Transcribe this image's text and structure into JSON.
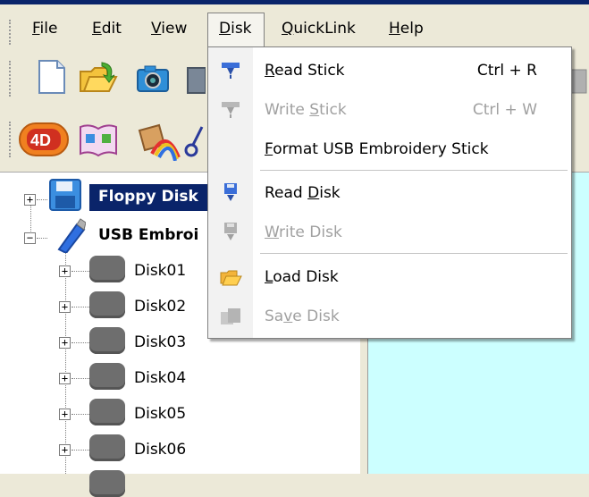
{
  "menubar": {
    "items": [
      {
        "label": "File",
        "u": "F",
        "rest": "ile"
      },
      {
        "label": "Edit",
        "u": "E",
        "rest": "dit"
      },
      {
        "label": "View",
        "u": "V",
        "rest": "iew"
      },
      {
        "label": "Disk",
        "u": "D",
        "rest": "isk"
      },
      {
        "label": "QuickLink",
        "u": "Q",
        "rest": "uickLink"
      },
      {
        "label": "Help",
        "u": "H",
        "rest": "elp"
      }
    ]
  },
  "disk_menu": {
    "items": [
      {
        "label": "Read Stick",
        "pre": "",
        "u": "R",
        "post": "ead Stick",
        "shortcut": "Ctrl + R",
        "enabled": true,
        "icon": "read-stick-icon"
      },
      {
        "label": "Write Stick",
        "pre": "Write ",
        "u": "S",
        "post": "tick",
        "shortcut": "Ctrl + W",
        "enabled": false,
        "icon": "write-stick-icon"
      },
      {
        "label": "Format USB Embroidery Stick",
        "pre": "",
        "u": "F",
        "post": "ormat USB Embroidery Stick",
        "shortcut": "",
        "enabled": true,
        "icon": ""
      },
      {
        "label": "Read Disk",
        "pre": "Read ",
        "u": "D",
        "post": "isk",
        "shortcut": "",
        "enabled": true,
        "icon": "read-disk-icon"
      },
      {
        "label": "Write Disk",
        "pre": "",
        "u": "W",
        "post": "rite Disk",
        "shortcut": "",
        "enabled": false,
        "icon": "write-disk-icon"
      },
      {
        "label": "Load Disk",
        "pre": "",
        "u": "L",
        "post": "oad Disk",
        "shortcut": "",
        "enabled": true,
        "icon": "load-disk-icon"
      },
      {
        "label": "Save Disk",
        "pre": "Sa",
        "u": "v",
        "post": "e Disk",
        "shortcut": "",
        "enabled": false,
        "icon": "save-disk-icon"
      }
    ]
  },
  "tree": {
    "floppy_label": "Floppy Disk",
    "usb_label": "USB Embroi",
    "disks": [
      "Disk01",
      "Disk02",
      "Disk03",
      "Disk04",
      "Disk05",
      "Disk06"
    ]
  },
  "colors": {
    "accent": "#0a246a",
    "right_panel": "#ccffff",
    "disabled_text": "#a0a0a0"
  }
}
